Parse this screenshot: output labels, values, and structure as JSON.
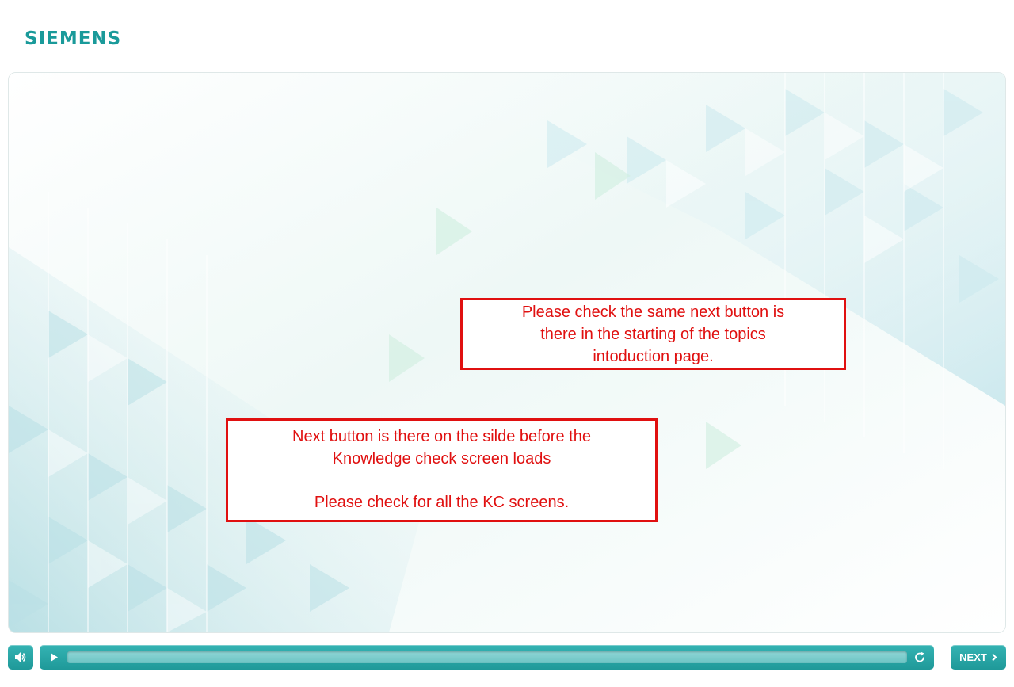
{
  "header": {
    "logo_text": "SIEMENS"
  },
  "notes": [
    {
      "lines": [
        "Please check the same next button is",
        "there in the starting of the topics",
        "intoduction page."
      ]
    },
    {
      "lines": [
        "Next button is there on the silde before the",
        "Knowledge check screen loads",
        "Please check for all the KC screens."
      ]
    }
  ],
  "player": {
    "next_label": "NEXT",
    "progress": 0,
    "icons": {
      "volume": "speaker-icon",
      "play": "play-icon",
      "replay": "replay-icon",
      "next": "chevron-right-icon"
    }
  },
  "colors": {
    "brand": "#1a9a9a",
    "annotation": "#e01010",
    "control": "#26a3a3"
  }
}
